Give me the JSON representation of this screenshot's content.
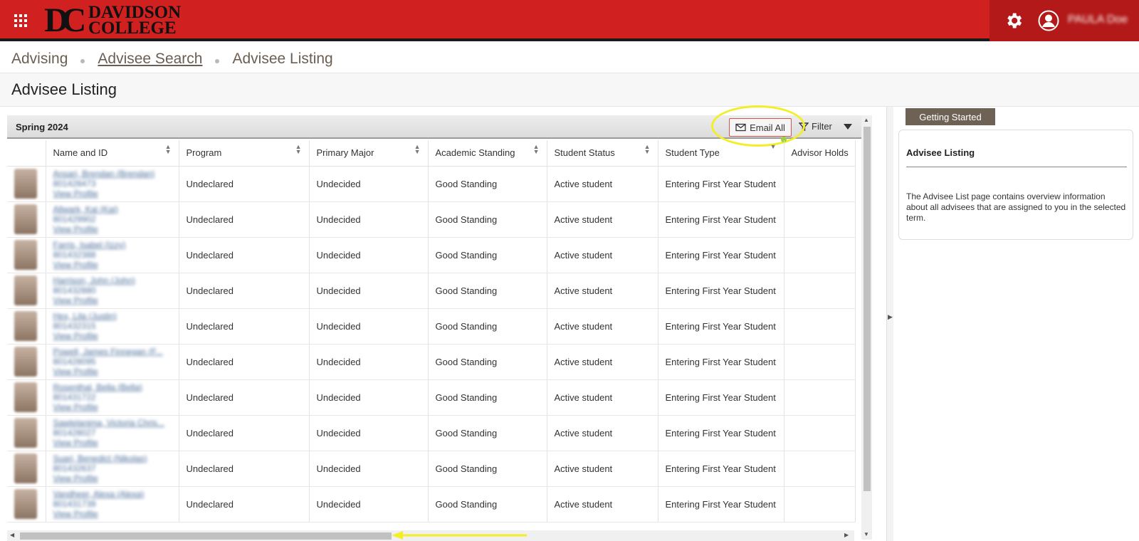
{
  "header": {
    "logo_mark": "DC",
    "logo_line1": "DAVIDSON",
    "logo_line2": "COLLEGE",
    "user_name": "PAULA Doe"
  },
  "breadcrumb": [
    {
      "label": "Advising"
    },
    {
      "label": "Advisee Search"
    },
    {
      "label": "Advisee Listing"
    }
  ],
  "page_title": "Advisee Listing",
  "toolbar": {
    "term": "Spring 2024",
    "email_all": "Email All",
    "filter": "Filter"
  },
  "table": {
    "columns": [
      "Name and ID",
      "Program",
      "Primary Major",
      "Academic Standing",
      "Student Status",
      "Student Type",
      "Advisor Holds"
    ],
    "rows": [
      {
        "name": "Ansari, Brendan (Brendan)",
        "id": "801428473",
        "link": "View Profile",
        "program": "Undeclared",
        "major": "Undecided",
        "standing": "Good Standing",
        "status": "Active student",
        "type": "Entering First Year Student"
      },
      {
        "name": "Allwark, Kai (Kai)",
        "id": "801429902",
        "link": "View Profile",
        "program": "Undeclared",
        "major": "Undecided",
        "standing": "Good Standing",
        "status": "Active student",
        "type": "Entering First Year Student"
      },
      {
        "name": "Farris, Isabel (Izzy)",
        "id": "801432388",
        "link": "View Profile",
        "program": "Undeclared",
        "major": "Undecided",
        "standing": "Good Standing",
        "status": "Active student",
        "type": "Entering First Year Student"
      },
      {
        "name": "Harrison, John (John)",
        "id": "801432880",
        "link": "View Profile",
        "program": "Undeclared",
        "major": "Undecided",
        "standing": "Good Standing",
        "status": "Active student",
        "type": "Entering First Year Student"
      },
      {
        "name": "Hex, Lila (Justin)",
        "id": "801432315",
        "link": "View Profile",
        "program": "Undeclared",
        "major": "Undecided",
        "standing": "Good Standing",
        "status": "Active student",
        "type": "Entering First Year Student"
      },
      {
        "name": "Powell, James Finnegan (F...",
        "id": "801428095",
        "link": "View Profile",
        "program": "Undeclared",
        "major": "Undecided",
        "standing": "Good Standing",
        "status": "Active student",
        "type": "Entering First Year Student"
      },
      {
        "name": "Rosenthal, Bella (Bella)",
        "id": "801431722",
        "link": "View Profile",
        "program": "Undeclared",
        "major": "Undecided",
        "standing": "Good Standing",
        "status": "Active student",
        "type": "Entering First Year Student"
      },
      {
        "name": "Sawtelanima, Victoria Chris...",
        "id": "801428027",
        "link": "View Profile",
        "program": "Undeclared",
        "major": "Undecided",
        "standing": "Good Standing",
        "status": "Active student",
        "type": "Entering First Year Student"
      },
      {
        "name": "Suari, Benedict (Nikolas)",
        "id": "801432637",
        "link": "View Profile",
        "program": "Undeclared",
        "major": "Undecided",
        "standing": "Good Standing",
        "status": "Active student",
        "type": "Entering First Year Student"
      },
      {
        "name": "Vandheer, Alexa (Alexa)",
        "id": "801431739",
        "link": "View Profile",
        "program": "Undeclared",
        "major": "Undecided",
        "standing": "Good Standing",
        "status": "Active student",
        "type": "Entering First Year Student"
      }
    ]
  },
  "side": {
    "tab": "Getting Started",
    "heading": "Advisee Listing",
    "body": "The Advisee List page contains overview information about all advisees that are assigned to you in the selected term."
  },
  "colors": {
    "brand_red": "#d0201f",
    "tab_brown": "#6d6255",
    "highlight_yellow": "#f2ee2a"
  }
}
